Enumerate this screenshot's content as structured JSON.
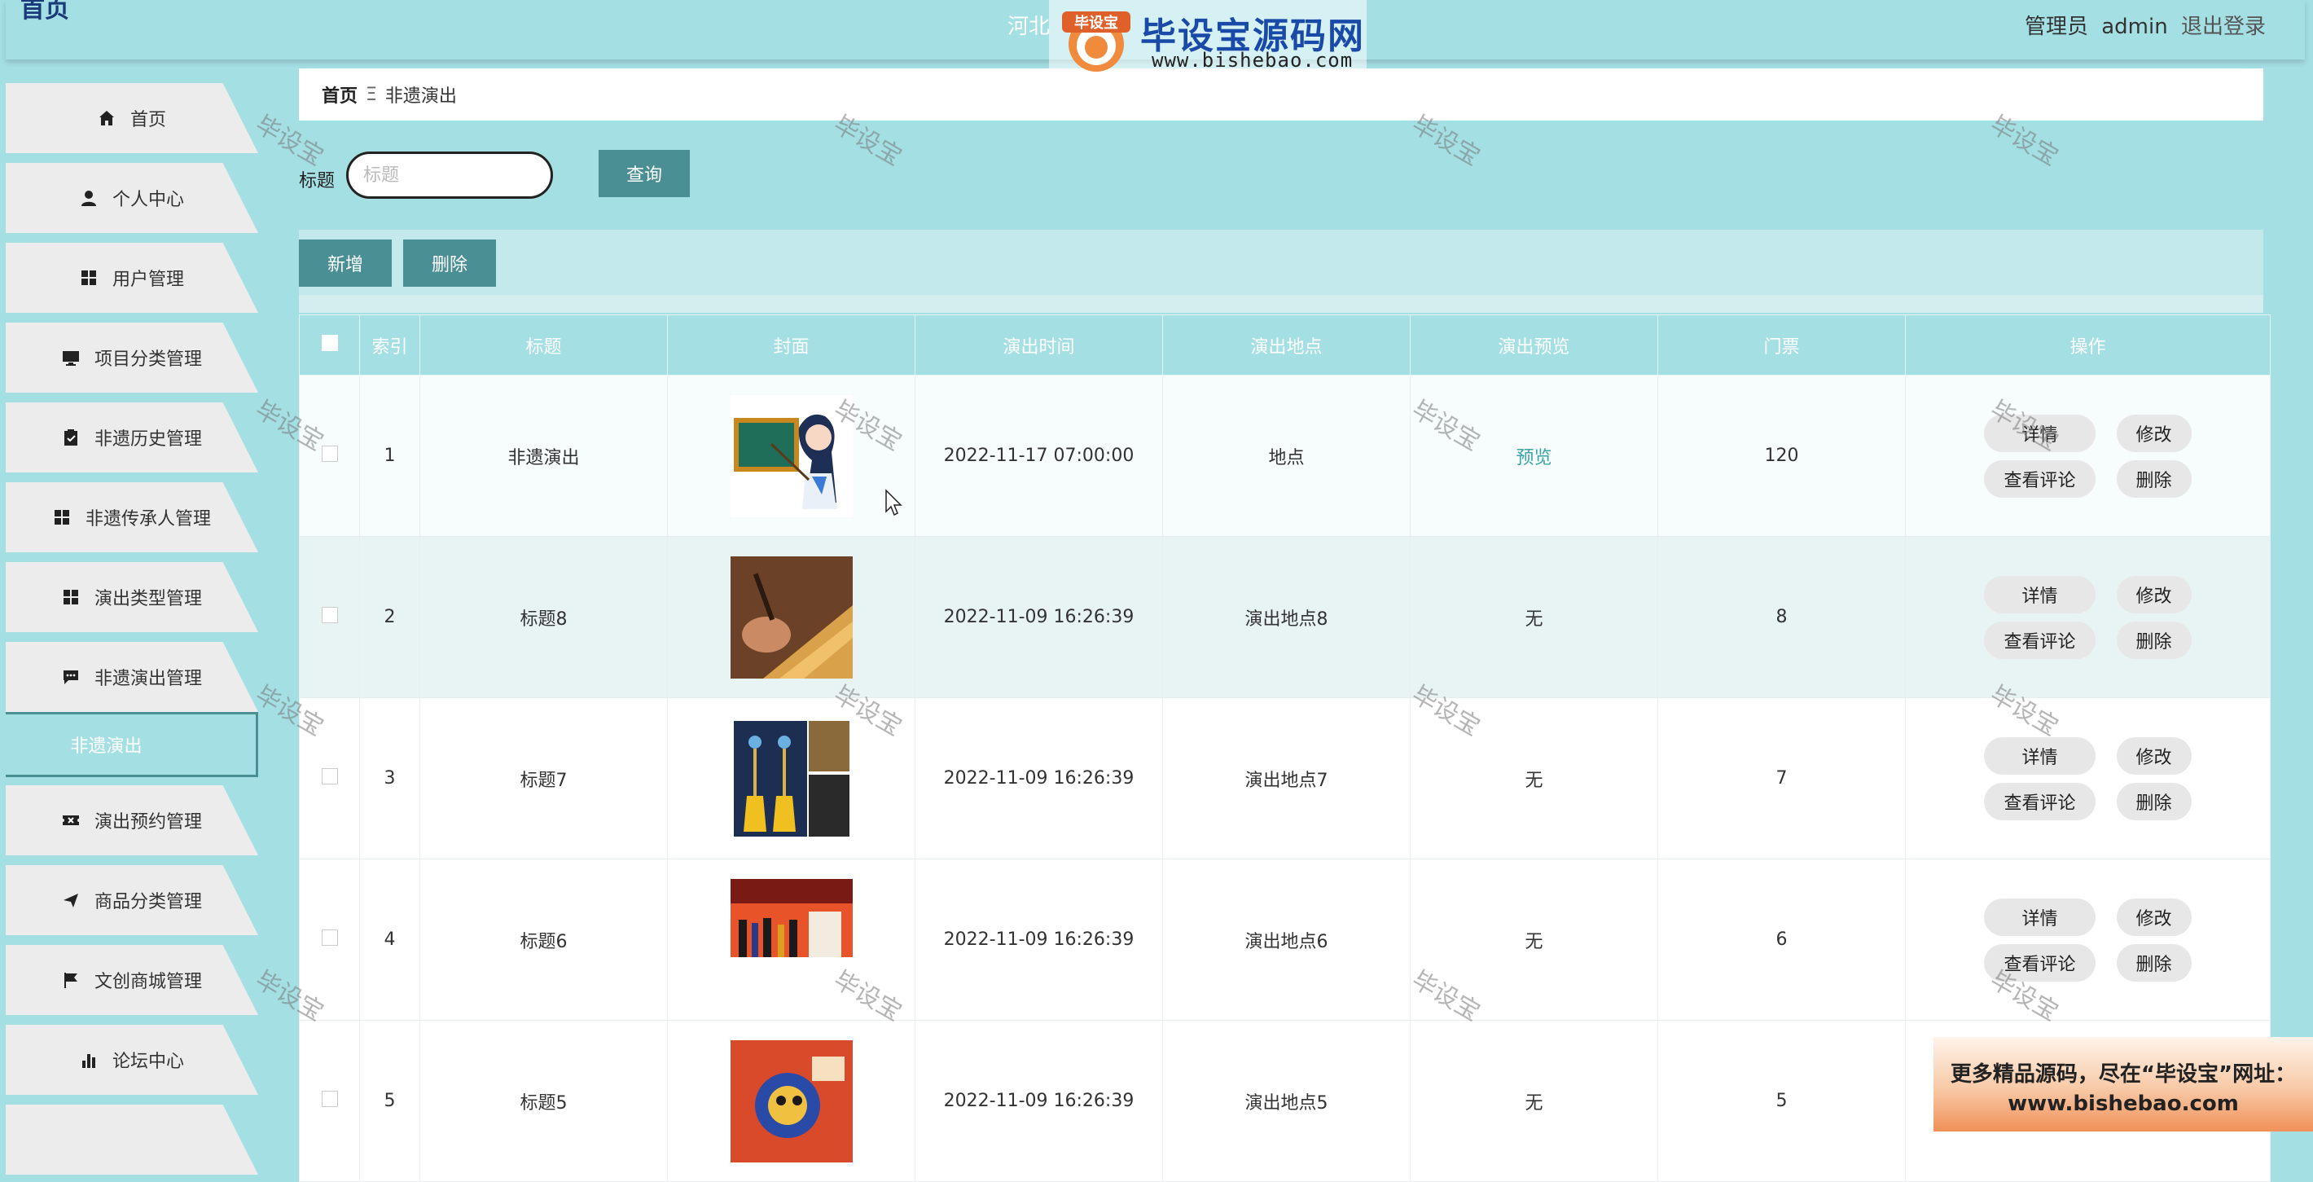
{
  "header": {
    "corner_title": "首页",
    "system_title": "河北",
    "user_role": "管理员",
    "username": "admin",
    "logout": "退出登录"
  },
  "watermark_logo": {
    "badge": "毕设宝",
    "name": "毕设宝源码网",
    "url": "www.bishebao.com"
  },
  "sidebar": {
    "items": [
      {
        "label": "首页",
        "icon": "home-icon"
      },
      {
        "label": "个人中心",
        "icon": "user-icon"
      },
      {
        "label": "用户管理",
        "icon": "grid-icon"
      },
      {
        "label": "项目分类管理",
        "icon": "monitor-icon"
      },
      {
        "label": "非遗历史管理",
        "icon": "clipboard-check-icon"
      },
      {
        "label": "非遗传承人管理",
        "icon": "grid-icon"
      },
      {
        "label": "演出类型管理",
        "icon": "grid-icon"
      },
      {
        "label": "非遗演出管理",
        "icon": "comment-icon"
      },
      {
        "label": "非遗演出",
        "icon": ""
      },
      {
        "label": "演出预约管理",
        "icon": "ticket-icon"
      },
      {
        "label": "商品分类管理",
        "icon": "send-icon"
      },
      {
        "label": "文创商城管理",
        "icon": "flag-icon"
      },
      {
        "label": "论坛中心",
        "icon": "chart-icon"
      }
    ]
  },
  "breadcrumb": {
    "home": "首页",
    "separator": "Ξ",
    "current": "非遗演出"
  },
  "search": {
    "label": "标题",
    "placeholder": "标题",
    "button": "查询"
  },
  "actions": {
    "add": "新增",
    "delete": "删除"
  },
  "table": {
    "headers": [
      "索引",
      "标题",
      "封面",
      "演出时间",
      "演出地点",
      "演出预览",
      "门票",
      "操作"
    ],
    "rows": [
      {
        "index": "1",
        "title": "非遗演出",
        "cover": "cartoon-teacher-image",
        "time": "2022-11-17 07:00:00",
        "place": "地点",
        "preview": "预览",
        "ticket": "120"
      },
      {
        "index": "2",
        "title": "标题8",
        "cover": "craft-carving-image",
        "time": "2022-11-09 16:26:39",
        "place": "演出地点8",
        "preview": "无",
        "ticket": "8"
      },
      {
        "index": "3",
        "title": "标题7",
        "cover": "tassel-ornament-image",
        "time": "2022-11-09 16:26:39",
        "place": "演出地点7",
        "preview": "无",
        "ticket": "7"
      },
      {
        "index": "4",
        "title": "标题6",
        "cover": "exhibition-shelf-image",
        "time": "2022-11-09 16:26:39",
        "place": "演出地点6",
        "preview": "无",
        "ticket": "6"
      },
      {
        "index": "5",
        "title": "标题5",
        "cover": "colorful-craft-image",
        "time": "2022-11-09 16:26:39",
        "place": "演出地点5",
        "preview": "无",
        "ticket": "5"
      }
    ],
    "op_labels": {
      "detail": "详情",
      "edit": "修改",
      "comments": "查看评论",
      "delete": "删除"
    }
  },
  "watermark_text": "毕设宝",
  "ad": {
    "line1": "更多精品源码，尽在“毕设宝”网址：",
    "line2": "www.bishebao.com"
  },
  "colors": {
    "theme": "#a4dfe4",
    "button": "#4a8f94",
    "preview_link": "#3aa5a8"
  }
}
